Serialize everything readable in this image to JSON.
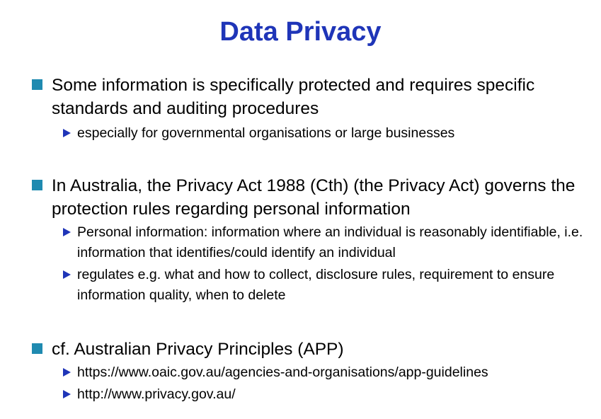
{
  "slide": {
    "title": "Data Privacy",
    "bullets": [
      {
        "text": "Some information is specifically protected and requires specific standards and auditing procedures",
        "sub": [
          "especially for governmental organisations  or large businesses"
        ]
      },
      {
        "text": "In Australia, the Privacy Act 1988 (Cth) (the Privacy Act) governs the protection rules regarding personal information",
        "sub": [
          "Personal information: information where an individual is reasonably identifiable, i.e. information that identifies/could identify an individual",
          "regulates e.g. what and how to collect, disclosure rules, requirement to ensure information quality, when to delete"
        ]
      },
      {
        "text": "cf. Australian Privacy Principles (APP)",
        "sub": [
          "https://www.oaic.gov.au/agencies-and-organisations/app-guidelines",
          "http://www.privacy.gov.au/"
        ]
      }
    ]
  },
  "colors": {
    "title": "#1f35b8",
    "square_bullet": "#1f8ab0",
    "triangle_bullet": "#1f35b8"
  },
  "icons": {
    "level1_bullet": "square-bullet-icon",
    "level2_bullet": "triangle-bullet-icon"
  }
}
